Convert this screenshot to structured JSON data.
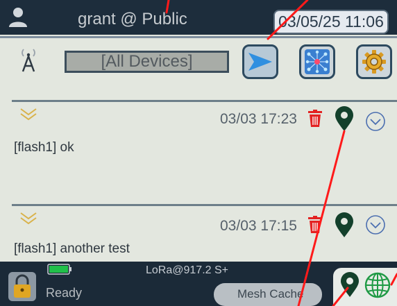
{
  "header": {
    "title": "grant @ Public",
    "datetime": "03/05/25 11:06"
  },
  "toolbar": {
    "device_filter": "[All Devices]",
    "icons": [
      "antenna-icon",
      "send-icon",
      "mesh-network-icon",
      "gear-icon"
    ]
  },
  "messages": [
    {
      "time": "03/03 17:23",
      "text": "[flash1] ok"
    },
    {
      "time": "03/03 17:15",
      "text": "[flash1] another test"
    }
  ],
  "status": {
    "radio": "LoRa@917.2 S+",
    "state": "Ready",
    "mesh_cache": "Mesh Cache"
  },
  "colors": {
    "header_bg": "#1d2d3c",
    "accent_blue": "#2f8fe0",
    "trash_red": "#e32222",
    "pin_green": "#13402b",
    "globe_green": "#1f9a45",
    "annotation_red": "#ff1a1a"
  }
}
